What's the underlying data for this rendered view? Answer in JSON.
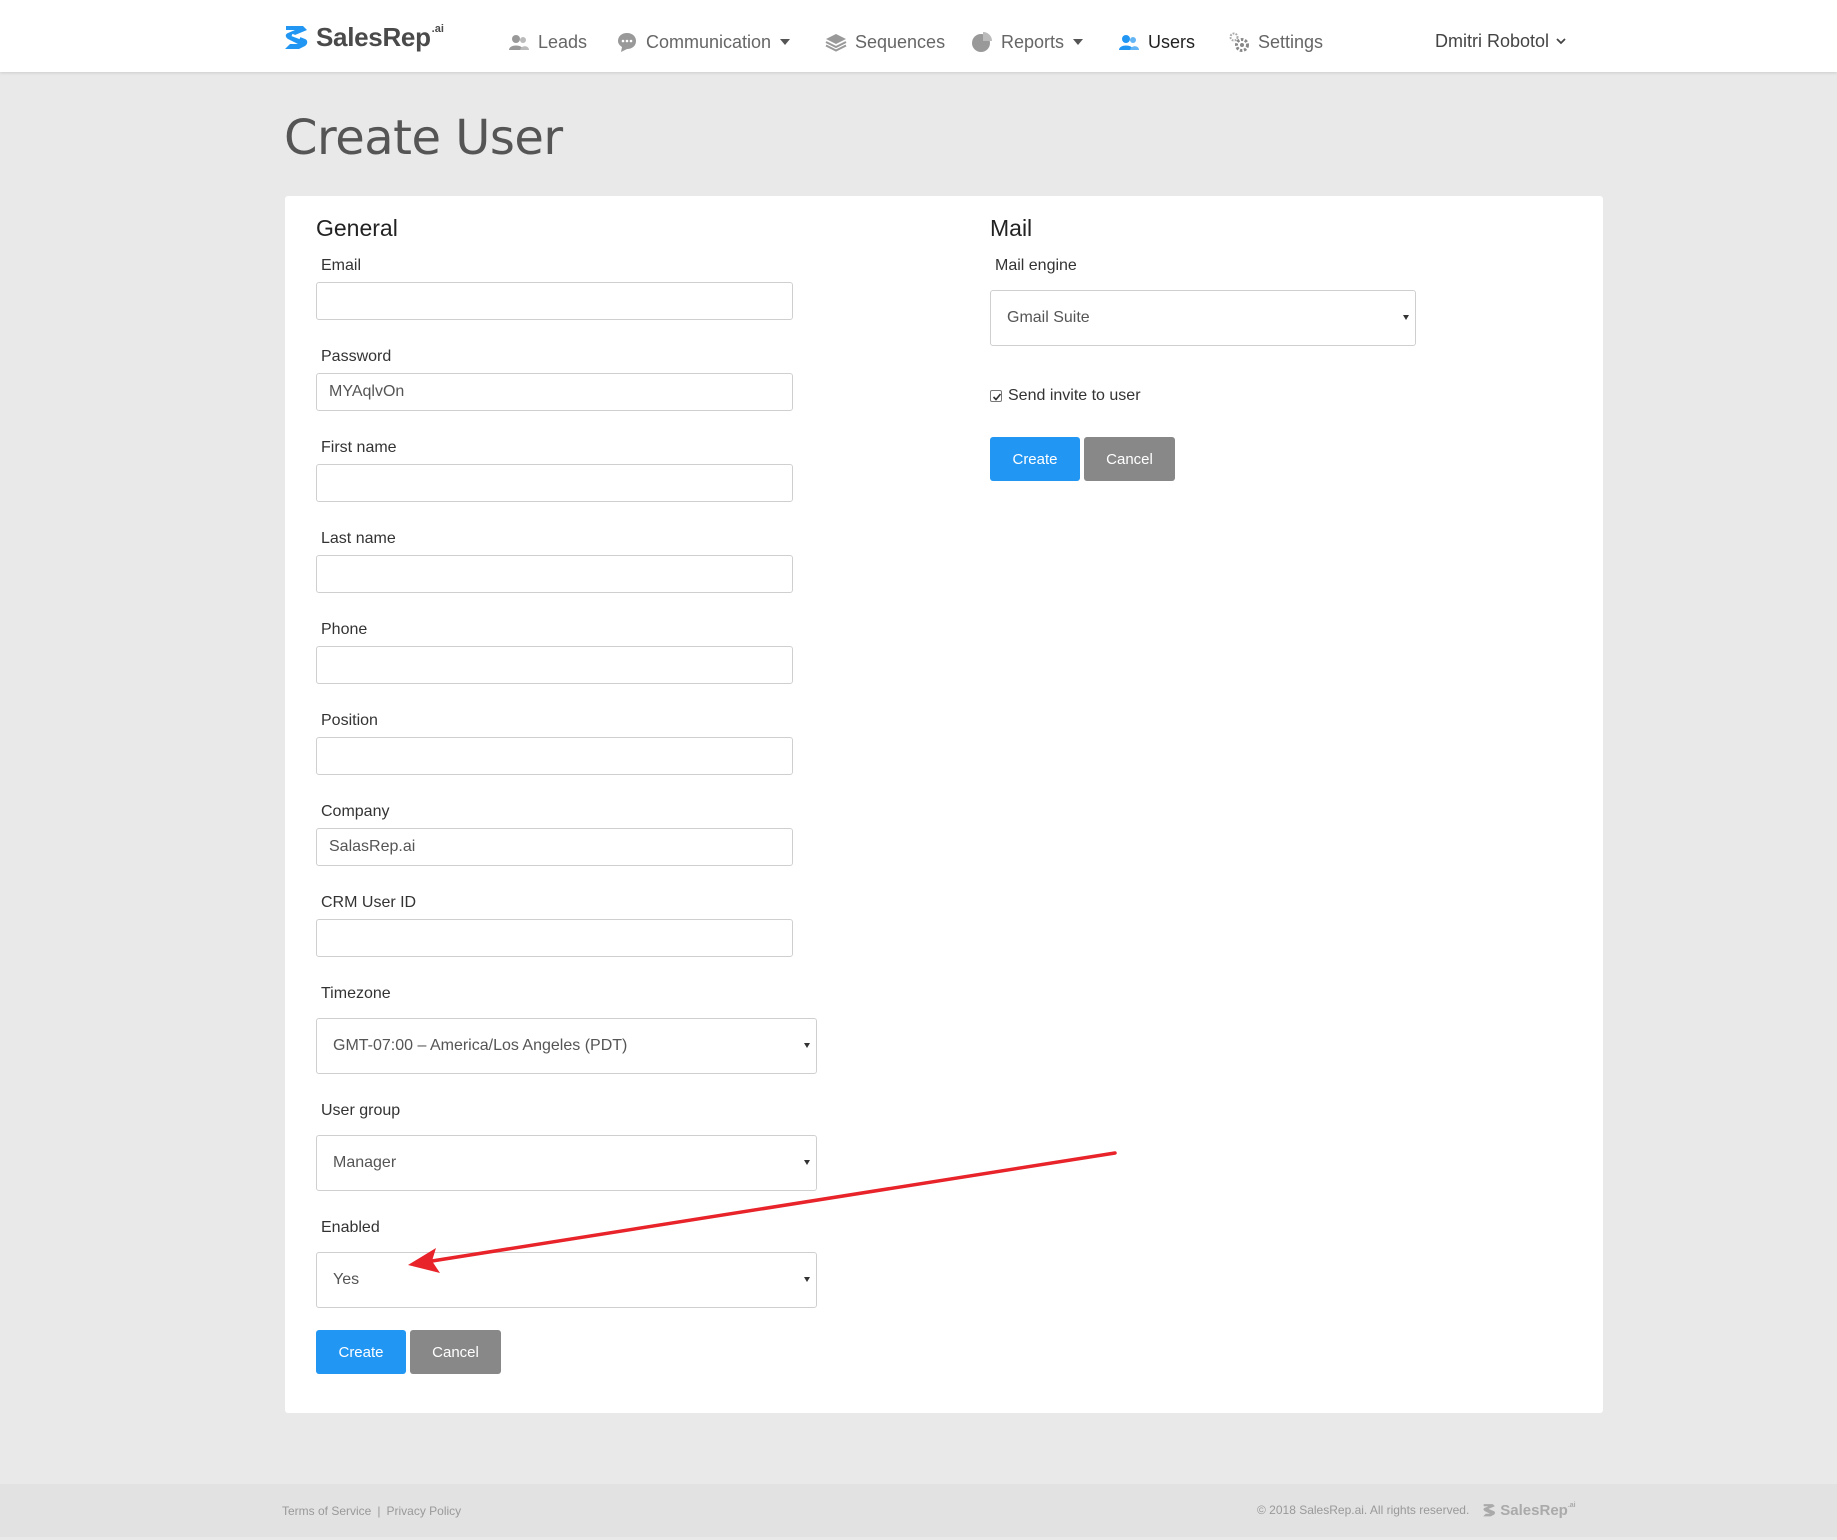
{
  "brand": {
    "name": "SalesRep",
    "suffix": ".ai",
    "accent_color": "#2196f3"
  },
  "nav": {
    "items": [
      {
        "label": "Leads",
        "icon": "users-icon"
      },
      {
        "label": "Communication",
        "icon": "chat-bubble-icon",
        "dropdown": true
      },
      {
        "label": "Sequences",
        "icon": "layers-icon"
      },
      {
        "label": "Reports",
        "icon": "pie-chart-icon",
        "dropdown": true
      },
      {
        "label": "Users",
        "icon": "users-icon",
        "active": true
      },
      {
        "label": "Settings",
        "icon": "gear-icon"
      }
    ],
    "user_name": "Dmitri Robotol"
  },
  "page": {
    "title": "Create User"
  },
  "general": {
    "title": "General",
    "fields": {
      "email": {
        "label": "Email",
        "value": ""
      },
      "password": {
        "label": "Password",
        "value": "MYAqlvOn"
      },
      "first_name": {
        "label": "First name",
        "value": ""
      },
      "last_name": {
        "label": "Last name",
        "value": ""
      },
      "phone": {
        "label": "Phone",
        "value": ""
      },
      "position": {
        "label": "Position",
        "value": ""
      },
      "company": {
        "label": "Company",
        "value": "SalasRep.ai"
      },
      "crm_user_id": {
        "label": "CRM User ID",
        "value": ""
      }
    },
    "timezone": {
      "label": "Timezone",
      "value": "GMT-07:00 – America/Los Angeles (PDT)"
    },
    "user_group": {
      "label": "User group",
      "value": "Manager"
    },
    "enabled": {
      "label": "Enabled",
      "value": "Yes"
    },
    "create_label": "Create",
    "cancel_label": "Cancel"
  },
  "mail": {
    "title": "Mail",
    "engine": {
      "label": "Mail engine",
      "value": "Gmail Suite"
    },
    "send_invite": {
      "label": "Send invite to user",
      "checked": true
    },
    "create_label": "Create",
    "cancel_label": "Cancel"
  },
  "annotation": {
    "color": "#e8232a"
  },
  "footer": {
    "terms": "Terms of Service",
    "separator": "|",
    "privacy": "Privacy Policy",
    "copyright": "© 2018 SalesRep.ai. All rights reserved.",
    "logo_name": "SalesRep",
    "logo_suffix": ".ai"
  }
}
